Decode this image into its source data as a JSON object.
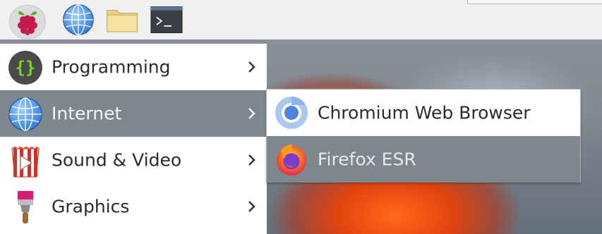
{
  "panel": {
    "launchers": [
      {
        "icon": "raspberry-menu-icon"
      },
      {
        "icon": "globe-icon"
      },
      {
        "icon": "folder-icon"
      },
      {
        "icon": "terminal-icon"
      }
    ]
  },
  "menu": {
    "items": [
      {
        "label": "Programming",
        "icon": "programming-icon"
      },
      {
        "label": "Internet",
        "icon": "globe-icon",
        "selected": true
      },
      {
        "label": "Sound & Video",
        "icon": "sound-video-icon"
      },
      {
        "label": "Graphics",
        "icon": "paintbrush-icon"
      }
    ]
  },
  "submenu": {
    "items": [
      {
        "label": "Chromium Web Browser",
        "icon": "chromium-icon"
      },
      {
        "label": "Firefox ESR",
        "icon": "firefox-icon",
        "selected": true
      }
    ]
  },
  "colors": {
    "selected_bg": "#7d878e",
    "panel_bg": "#f0f0f0",
    "menu_bg": "#ffffff"
  }
}
